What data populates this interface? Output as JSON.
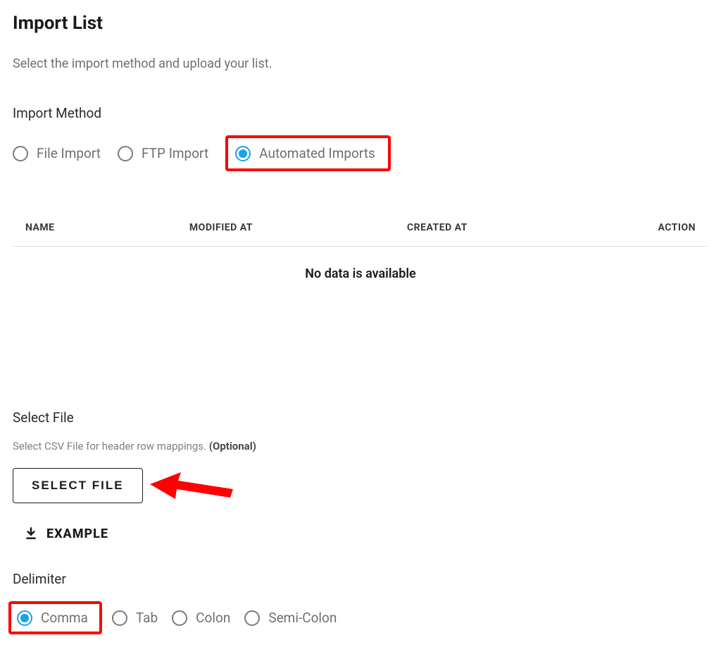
{
  "title": "Import List",
  "subheading": "Select the import method and upload your list.",
  "import_method": {
    "label": "Import Method",
    "options": [
      {
        "id": "file",
        "label": "File Import",
        "selected": false,
        "highlight": false
      },
      {
        "id": "ftp",
        "label": "FTP Import",
        "selected": false,
        "highlight": false
      },
      {
        "id": "auto",
        "label": "Automated Imports",
        "selected": true,
        "highlight": true
      }
    ]
  },
  "table": {
    "columns": {
      "name": "NAME",
      "modified": "MODIFIED AT",
      "created": "CREATED AT",
      "action": "ACTION"
    },
    "empty_message": "No data is available"
  },
  "select_file": {
    "label": "Select File",
    "help_prefix": "Select CSV File for header row mappings. ",
    "help_optional": "(Optional)",
    "button_label": "SELECT FILE",
    "example_label": "EXAMPLE"
  },
  "delimiter": {
    "label": "Delimiter",
    "options": [
      {
        "id": "comma",
        "label": "Comma",
        "selected": true,
        "highlight": true
      },
      {
        "id": "tab",
        "label": "Tab",
        "selected": false,
        "highlight": false
      },
      {
        "id": "colon",
        "label": "Colon",
        "selected": false,
        "highlight": false
      },
      {
        "id": "semicolon",
        "label": "Semi-Colon",
        "selected": false,
        "highlight": false
      }
    ]
  },
  "annotations": {
    "highlight_color": "#ff0000",
    "accent_color": "#1ba2e6"
  }
}
